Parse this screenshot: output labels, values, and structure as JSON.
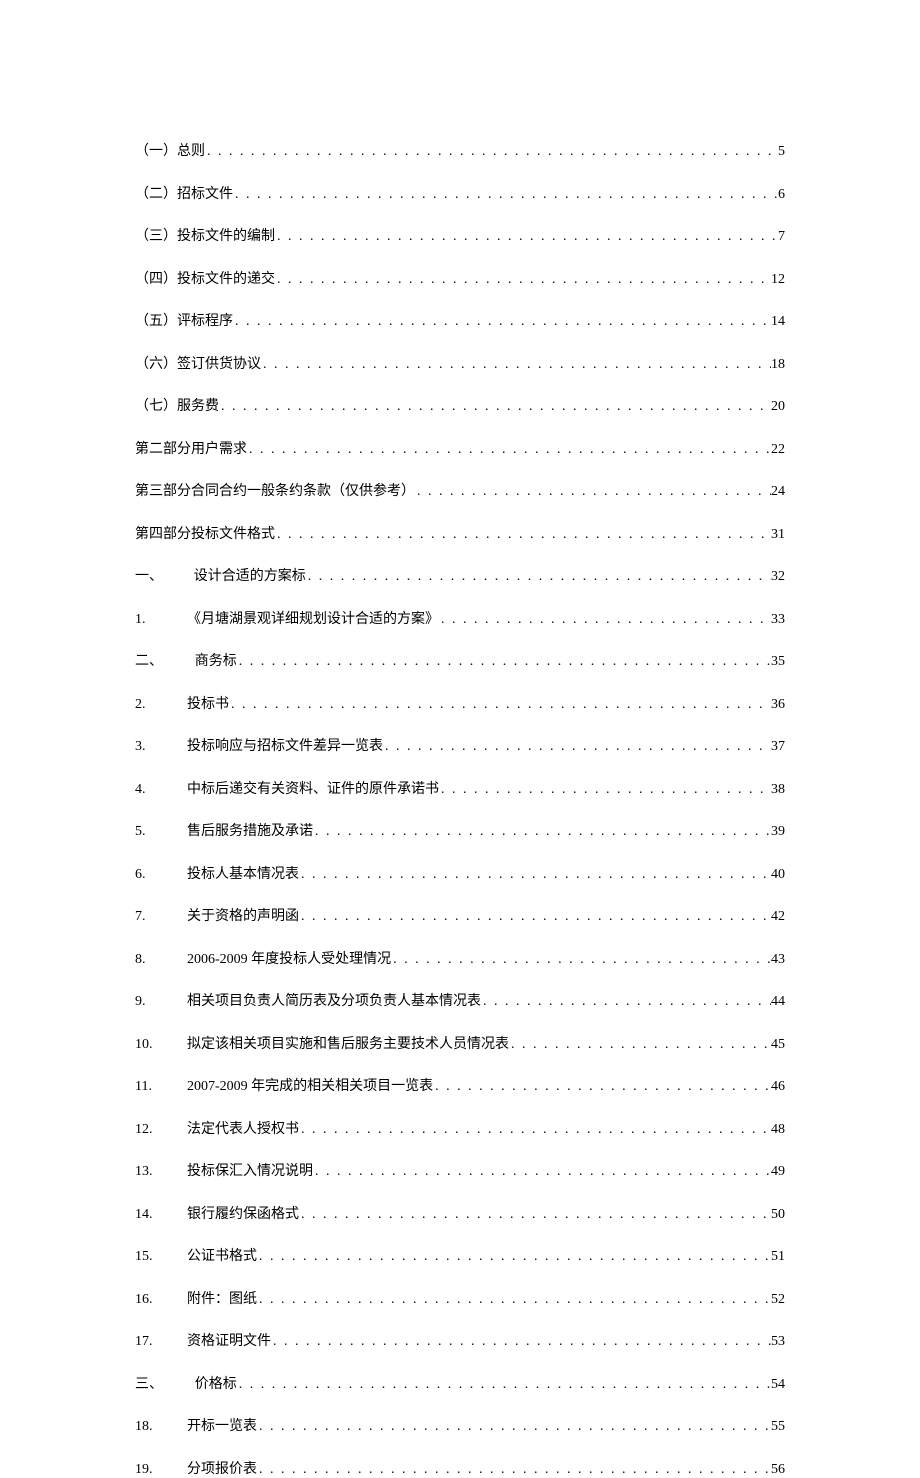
{
  "toc": [
    {
      "prefix": "（一）",
      "title": "总则",
      "page": "5",
      "style": "paren"
    },
    {
      "prefix": "（二）",
      "title": "招标文件",
      "page": "6",
      "style": "paren"
    },
    {
      "prefix": "（三）",
      "title": "投标文件的编制",
      "page": "7",
      "style": "paren"
    },
    {
      "prefix": "（四）",
      "title": "投标文件的递交",
      "page": "12",
      "style": "paren"
    },
    {
      "prefix": "（五）",
      "title": "评标程序",
      "page": "14",
      "style": "paren"
    },
    {
      "prefix": "（六）",
      "title": "签订供货协议",
      "page": "18",
      "style": "paren"
    },
    {
      "prefix": "（七）",
      "title": "服务费",
      "page": "20",
      "style": "paren"
    },
    {
      "prefix": "",
      "title": "第二部分用户需求",
      "page": "22",
      "style": "plain"
    },
    {
      "prefix": "",
      "title": "第三部分合同合约一般条约条款（仅供参考）",
      "page": "24",
      "style": "plain"
    },
    {
      "prefix": "",
      "title": "第四部分投标文件格式",
      "page": "31",
      "style": "plain"
    },
    {
      "prefix": "一、",
      "title": "设计合适的方案标",
      "page": "32",
      "style": "indent"
    },
    {
      "prefix": "1.",
      "title": "《月塘湖景观详细规划设计合适的方案》",
      "page": "33",
      "style": "num"
    },
    {
      "prefix": "二、",
      "title": "商务标",
      "page": "35",
      "style": "indent"
    },
    {
      "prefix": "2.",
      "title": "投标书",
      "page": "36",
      "style": "num"
    },
    {
      "prefix": "3.",
      "title": "投标响应与招标文件差异一览表",
      "page": "37",
      "style": "num"
    },
    {
      "prefix": "4.",
      "title": "中标后递交有关资料、证件的原件承诺书",
      "page": "38",
      "style": "num"
    },
    {
      "prefix": "5.",
      "title": "售后服务措施及承诺",
      "page": "39",
      "style": "num"
    },
    {
      "prefix": "6.",
      "title": "投标人基本情况表",
      "page": "40",
      "style": "num"
    },
    {
      "prefix": "7.",
      "title": "关于资格的声明函",
      "page": "42",
      "style": "num"
    },
    {
      "prefix": "8.",
      "title": "2006-2009 年度投标人受处理情况",
      "page": "43",
      "style": "num"
    },
    {
      "prefix": "9.",
      "title": "相关项目负责人简历表及分项负责人基本情况表",
      "page": "44",
      "style": "num"
    },
    {
      "prefix": "10.",
      "title": "拟定该相关项目实施和售后服务主要技术人员情况表",
      "page": "45",
      "style": "num"
    },
    {
      "prefix": "11.",
      "title": "2007-2009 年完成的相关相关项目一览表",
      "page": "46",
      "style": "num"
    },
    {
      "prefix": "12.",
      "title": "法定代表人授权书",
      "page": "48",
      "style": "num"
    },
    {
      "prefix": "13.",
      "title": "投标保汇入情况说明",
      "page": "49",
      "style": "num"
    },
    {
      "prefix": "14.",
      "title": "银行履约保函格式",
      "page": "50",
      "style": "num"
    },
    {
      "prefix": "15.",
      "title": "公证书格式",
      "page": "51",
      "style": "num"
    },
    {
      "prefix": "16.",
      "title": "附件：图纸",
      "page": "52",
      "style": "num"
    },
    {
      "prefix": "17.",
      "title": "资格证明文件",
      "page": "53",
      "style": "num"
    },
    {
      "prefix": "三、",
      "title": "价格标",
      "page": "54",
      "style": "indent"
    },
    {
      "prefix": "18.",
      "title": "开标一览表",
      "page": "55",
      "style": "num"
    },
    {
      "prefix": "19.",
      "title": "分项报价表",
      "page": "56",
      "style": "num"
    }
  ]
}
